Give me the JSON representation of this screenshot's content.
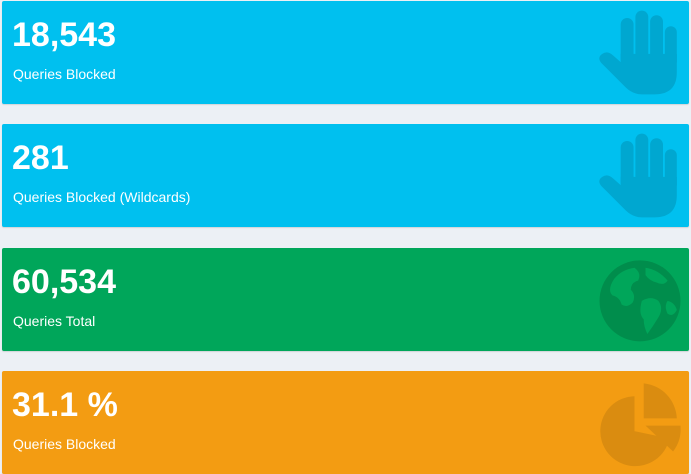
{
  "cards": [
    {
      "value": "18,543",
      "label": "Queries Blocked",
      "icon": "hand-icon",
      "color": "#00c0ef",
      "icon_color": "#00a7d0"
    },
    {
      "value": "281",
      "label": "Queries Blocked (Wildcards)",
      "icon": "hand-icon",
      "color": "#00c0ef",
      "icon_color": "#00a7d0"
    },
    {
      "value": "60,534",
      "label": "Queries Total",
      "icon": "globe-icon",
      "color": "#00a65a",
      "icon_color": "#008d4c"
    },
    {
      "value": "31.1 %",
      "label": "Queries Blocked",
      "icon": "pie-chart-icon",
      "color": "#f39c12",
      "icon_color": "#da8c10"
    }
  ]
}
